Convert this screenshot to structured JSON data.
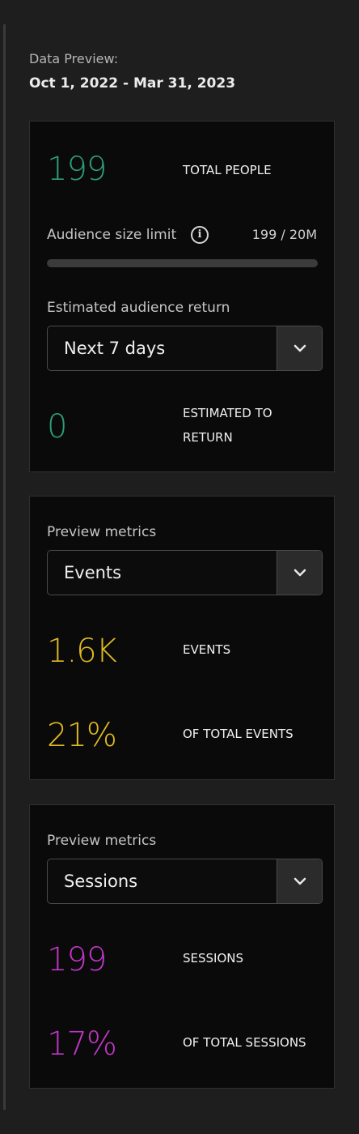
{
  "header": {
    "label": "Data Preview:",
    "date_range": "Oct 1, 2022 - Mar 31, 2023"
  },
  "audience_card": {
    "total_people_value": "199",
    "total_people_label": "TOTAL PEOPLE",
    "size_limit_label": "Audience size limit",
    "size_limit_value": "199 / 20M",
    "size_limit_fraction": 1e-05,
    "return_label": "Estimated audience return",
    "return_selected": "Next 7 days",
    "estimated_value": "0",
    "estimated_label_line1": "ESTIMATED TO",
    "estimated_label_line2": "RETURN"
  },
  "events_card": {
    "metrics_label": "Preview metrics",
    "selected": "Events",
    "value": "1.6K",
    "value_label": "EVENTS",
    "percent": "21%",
    "percent_label": "OF TOTAL EVENTS"
  },
  "sessions_card": {
    "metrics_label": "Preview metrics",
    "selected": "Sessions",
    "value": "199",
    "value_label": "SESSIONS",
    "percent": "17%",
    "percent_label": "OF TOTAL SESSIONS"
  },
  "colors": {
    "people": "#2d9d78",
    "events": "#e0b921",
    "sessions": "#c037c7"
  },
  "icons": {
    "info": "info-icon",
    "dropdown": "chevron-down-icon"
  }
}
